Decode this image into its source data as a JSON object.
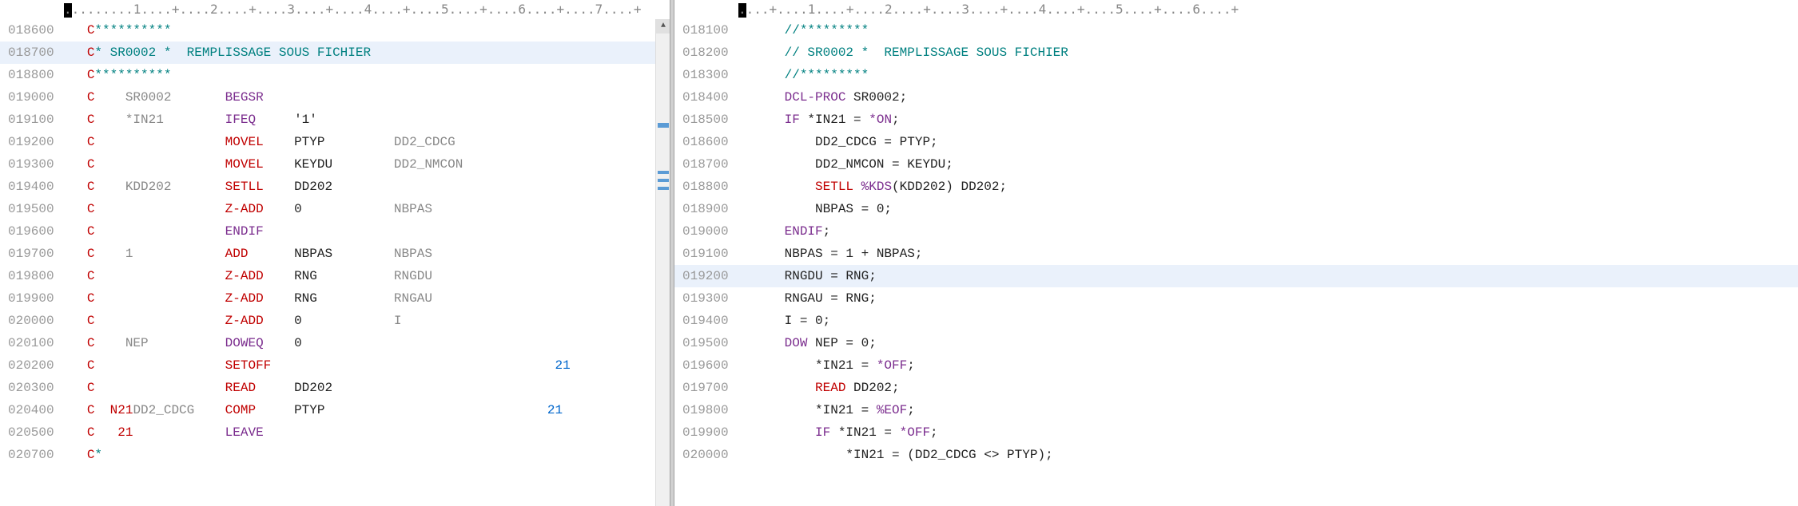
{
  "left": {
    "ruler": ".........1....+....2....+....3....+....4....+....5....+....6....+....7....+",
    "lines": [
      {
        "num": "018600",
        "hl": false,
        "segs": [
          {
            "cls": "c-red",
            "t": "C"
          },
          {
            "cls": "c-teal",
            "t": "**********"
          }
        ]
      },
      {
        "num": "018700",
        "hl": true,
        "segs": [
          {
            "cls": "c-red",
            "t": "C"
          },
          {
            "cls": "c-teal",
            "t": "* SR0002 *  REMPLISSAGE SOUS FICHIER"
          }
        ]
      },
      {
        "num": "018800",
        "hl": false,
        "segs": [
          {
            "cls": "c-red",
            "t": "C"
          },
          {
            "cls": "c-teal",
            "t": "**********"
          }
        ]
      },
      {
        "num": "019000",
        "hl": false,
        "segs": [
          {
            "cls": "c-red",
            "t": "C"
          },
          {
            "cls": "c-gray",
            "t": "    SR0002       "
          },
          {
            "cls": "c-purple",
            "t": "BEGSR"
          }
        ]
      },
      {
        "num": "019100",
        "hl": false,
        "segs": [
          {
            "cls": "c-red",
            "t": "C"
          },
          {
            "cls": "c-gray",
            "t": "    *IN21        "
          },
          {
            "cls": "c-purple",
            "t": "IFEQ"
          },
          {
            "cls": "c-black",
            "t": "     '1'"
          }
        ]
      },
      {
        "num": "019200",
        "hl": false,
        "segs": [
          {
            "cls": "c-red",
            "t": "C"
          },
          {
            "cls": "c-gray",
            "t": "                 "
          },
          {
            "cls": "c-red",
            "t": "MOVEL"
          },
          {
            "cls": "c-black",
            "t": "    PTYP"
          },
          {
            "cls": "c-gray",
            "t": "         DD2_CDCG"
          }
        ]
      },
      {
        "num": "019300",
        "hl": false,
        "segs": [
          {
            "cls": "c-red",
            "t": "C"
          },
          {
            "cls": "c-gray",
            "t": "                 "
          },
          {
            "cls": "c-red",
            "t": "MOVEL"
          },
          {
            "cls": "c-black",
            "t": "    KEYDU"
          },
          {
            "cls": "c-gray",
            "t": "        DD2_NMCON"
          }
        ]
      },
      {
        "num": "019400",
        "hl": false,
        "segs": [
          {
            "cls": "c-red",
            "t": "C"
          },
          {
            "cls": "c-gray",
            "t": "    KDD202       "
          },
          {
            "cls": "c-red",
            "t": "SETLL"
          },
          {
            "cls": "c-black",
            "t": "    DD202"
          }
        ]
      },
      {
        "num": "019500",
        "hl": false,
        "segs": [
          {
            "cls": "c-red",
            "t": "C"
          },
          {
            "cls": "c-gray",
            "t": "                 "
          },
          {
            "cls": "c-red",
            "t": "Z-ADD"
          },
          {
            "cls": "c-black",
            "t": "    0"
          },
          {
            "cls": "c-gray",
            "t": "            NBPAS"
          }
        ]
      },
      {
        "num": "019600",
        "hl": false,
        "segs": [
          {
            "cls": "c-red",
            "t": "C"
          },
          {
            "cls": "c-gray",
            "t": "                 "
          },
          {
            "cls": "c-purple",
            "t": "ENDIF"
          }
        ]
      },
      {
        "num": "019700",
        "hl": false,
        "segs": [
          {
            "cls": "c-red",
            "t": "C"
          },
          {
            "cls": "c-gray",
            "t": "    1            "
          },
          {
            "cls": "c-red",
            "t": "ADD"
          },
          {
            "cls": "c-black",
            "t": "      NBPAS"
          },
          {
            "cls": "c-gray",
            "t": "        NBPAS"
          }
        ]
      },
      {
        "num": "019800",
        "hl": false,
        "segs": [
          {
            "cls": "c-red",
            "t": "C"
          },
          {
            "cls": "c-gray",
            "t": "                 "
          },
          {
            "cls": "c-red",
            "t": "Z-ADD"
          },
          {
            "cls": "c-black",
            "t": "    RNG"
          },
          {
            "cls": "c-gray",
            "t": "          RNGDU"
          }
        ]
      },
      {
        "num": "019900",
        "hl": false,
        "segs": [
          {
            "cls": "c-red",
            "t": "C"
          },
          {
            "cls": "c-gray",
            "t": "                 "
          },
          {
            "cls": "c-red",
            "t": "Z-ADD"
          },
          {
            "cls": "c-black",
            "t": "    RNG"
          },
          {
            "cls": "c-gray",
            "t": "          RNGAU"
          }
        ]
      },
      {
        "num": "020000",
        "hl": false,
        "segs": [
          {
            "cls": "c-red",
            "t": "C"
          },
          {
            "cls": "c-gray",
            "t": "                 "
          },
          {
            "cls": "c-red",
            "t": "Z-ADD"
          },
          {
            "cls": "c-black",
            "t": "    0"
          },
          {
            "cls": "c-gray",
            "t": "            I"
          }
        ]
      },
      {
        "num": "020100",
        "hl": false,
        "segs": [
          {
            "cls": "c-red",
            "t": "C"
          },
          {
            "cls": "c-gray",
            "t": "    NEP          "
          },
          {
            "cls": "c-purple",
            "t": "DOWEQ"
          },
          {
            "cls": "c-black",
            "t": "    0"
          }
        ]
      },
      {
        "num": "020200",
        "hl": false,
        "segs": [
          {
            "cls": "c-red",
            "t": "C"
          },
          {
            "cls": "c-gray",
            "t": "                 "
          },
          {
            "cls": "c-red",
            "t": "SETOFF"
          },
          {
            "cls": "c-blue",
            "t": "                                     21"
          }
        ]
      },
      {
        "num": "020300",
        "hl": false,
        "segs": [
          {
            "cls": "c-red",
            "t": "C"
          },
          {
            "cls": "c-gray",
            "t": "                 "
          },
          {
            "cls": "c-red",
            "t": "READ"
          },
          {
            "cls": "c-black",
            "t": "     DD202"
          }
        ]
      },
      {
        "num": "020400",
        "hl": false,
        "segs": [
          {
            "cls": "c-red",
            "t": "C"
          },
          {
            "cls": "c-red",
            "t": "  N21"
          },
          {
            "cls": "c-gray",
            "t": "DD2_CDCG    "
          },
          {
            "cls": "c-red",
            "t": "COMP"
          },
          {
            "cls": "c-black",
            "t": "     PTYP"
          },
          {
            "cls": "c-blue",
            "t": "                             21"
          }
        ]
      },
      {
        "num": "020500",
        "hl": false,
        "segs": [
          {
            "cls": "c-red",
            "t": "C"
          },
          {
            "cls": "c-red",
            "t": "   21"
          },
          {
            "cls": "c-gray",
            "t": "            "
          },
          {
            "cls": "c-purple",
            "t": "LEAVE"
          }
        ]
      },
      {
        "num": "020700",
        "hl": false,
        "segs": [
          {
            "cls": "c-red",
            "t": "C"
          },
          {
            "cls": "c-teal",
            "t": "*"
          }
        ]
      }
    ]
  },
  "right": {
    "ruler": "....+....1....+....2....+....3....+....4....+....5....+....6....+",
    "lines": [
      {
        "num": "018100",
        "hl": false,
        "segs": [
          {
            "cls": "c-teal",
            "t": "//*********"
          }
        ]
      },
      {
        "num": "018200",
        "hl": false,
        "segs": [
          {
            "cls": "c-teal",
            "t": "// SR0002 *  REMPLISSAGE SOUS FICHIER"
          }
        ]
      },
      {
        "num": "018300",
        "hl": false,
        "segs": [
          {
            "cls": "c-teal",
            "t": "//*********"
          }
        ]
      },
      {
        "num": "018400",
        "hl": false,
        "segs": [
          {
            "cls": "c-purple",
            "t": "DCL-PROC"
          },
          {
            "cls": "c-black",
            "t": " SR0002;"
          }
        ]
      },
      {
        "num": "018500",
        "hl": false,
        "segs": [
          {
            "cls": "c-purple",
            "t": "IF"
          },
          {
            "cls": "c-black",
            "t": " *IN21 = "
          },
          {
            "cls": "c-purple",
            "t": "*ON"
          },
          {
            "cls": "c-black",
            "t": ";"
          }
        ]
      },
      {
        "num": "018600",
        "hl": false,
        "segs": [
          {
            "cls": "c-black",
            "t": "    DD2_CDCG = PTYP;"
          }
        ]
      },
      {
        "num": "018700",
        "hl": false,
        "segs": [
          {
            "cls": "c-black",
            "t": "    DD2_NMCON = KEYDU;"
          }
        ]
      },
      {
        "num": "018800",
        "hl": false,
        "segs": [
          {
            "cls": "c-black",
            "t": "    "
          },
          {
            "cls": "c-red",
            "t": "SETLL"
          },
          {
            "cls": "c-black",
            "t": " "
          },
          {
            "cls": "c-purple",
            "t": "%KDS"
          },
          {
            "cls": "c-black",
            "t": "(KDD202) DD202;"
          }
        ]
      },
      {
        "num": "018900",
        "hl": false,
        "segs": [
          {
            "cls": "c-black",
            "t": "    NBPAS = 0;"
          }
        ]
      },
      {
        "num": "019000",
        "hl": false,
        "segs": [
          {
            "cls": "c-purple",
            "t": "ENDIF"
          },
          {
            "cls": "c-black",
            "t": ";"
          }
        ]
      },
      {
        "num": "019100",
        "hl": false,
        "segs": [
          {
            "cls": "c-black",
            "t": "NBPAS = 1 + NBPAS;"
          }
        ]
      },
      {
        "num": "019200",
        "hl": true,
        "segs": [
          {
            "cls": "c-black",
            "t": "RNGDU = RNG;"
          }
        ]
      },
      {
        "num": "019300",
        "hl": false,
        "segs": [
          {
            "cls": "c-black",
            "t": "RNGAU = RNG;"
          }
        ]
      },
      {
        "num": "019400",
        "hl": false,
        "segs": [
          {
            "cls": "c-black",
            "t": "I = 0;"
          }
        ]
      },
      {
        "num": "019500",
        "hl": false,
        "segs": [
          {
            "cls": "c-purple",
            "t": "DOW"
          },
          {
            "cls": "c-black",
            "t": " NEP = 0;"
          }
        ]
      },
      {
        "num": "019600",
        "hl": false,
        "segs": [
          {
            "cls": "c-black",
            "t": "    *IN21 = "
          },
          {
            "cls": "c-purple",
            "t": "*OFF"
          },
          {
            "cls": "c-black",
            "t": ";"
          }
        ]
      },
      {
        "num": "019700",
        "hl": false,
        "segs": [
          {
            "cls": "c-black",
            "t": "    "
          },
          {
            "cls": "c-red",
            "t": "READ"
          },
          {
            "cls": "c-black",
            "t": " DD202;"
          }
        ]
      },
      {
        "num": "019800",
        "hl": false,
        "segs": [
          {
            "cls": "c-black",
            "t": "    *IN21 = "
          },
          {
            "cls": "c-purple",
            "t": "%EOF"
          },
          {
            "cls": "c-black",
            "t": ";"
          }
        ]
      },
      {
        "num": "019900",
        "hl": false,
        "segs": [
          {
            "cls": "c-black",
            "t": "    "
          },
          {
            "cls": "c-purple",
            "t": "IF"
          },
          {
            "cls": "c-black",
            "t": " *IN21 = "
          },
          {
            "cls": "c-purple",
            "t": "*OFF"
          },
          {
            "cls": "c-black",
            "t": ";"
          }
        ]
      },
      {
        "num": "020000",
        "hl": false,
        "segs": [
          {
            "cls": "c-black",
            "t": "        *IN21 = (DD2_CDCG <> PTYP);"
          }
        ]
      }
    ]
  }
}
